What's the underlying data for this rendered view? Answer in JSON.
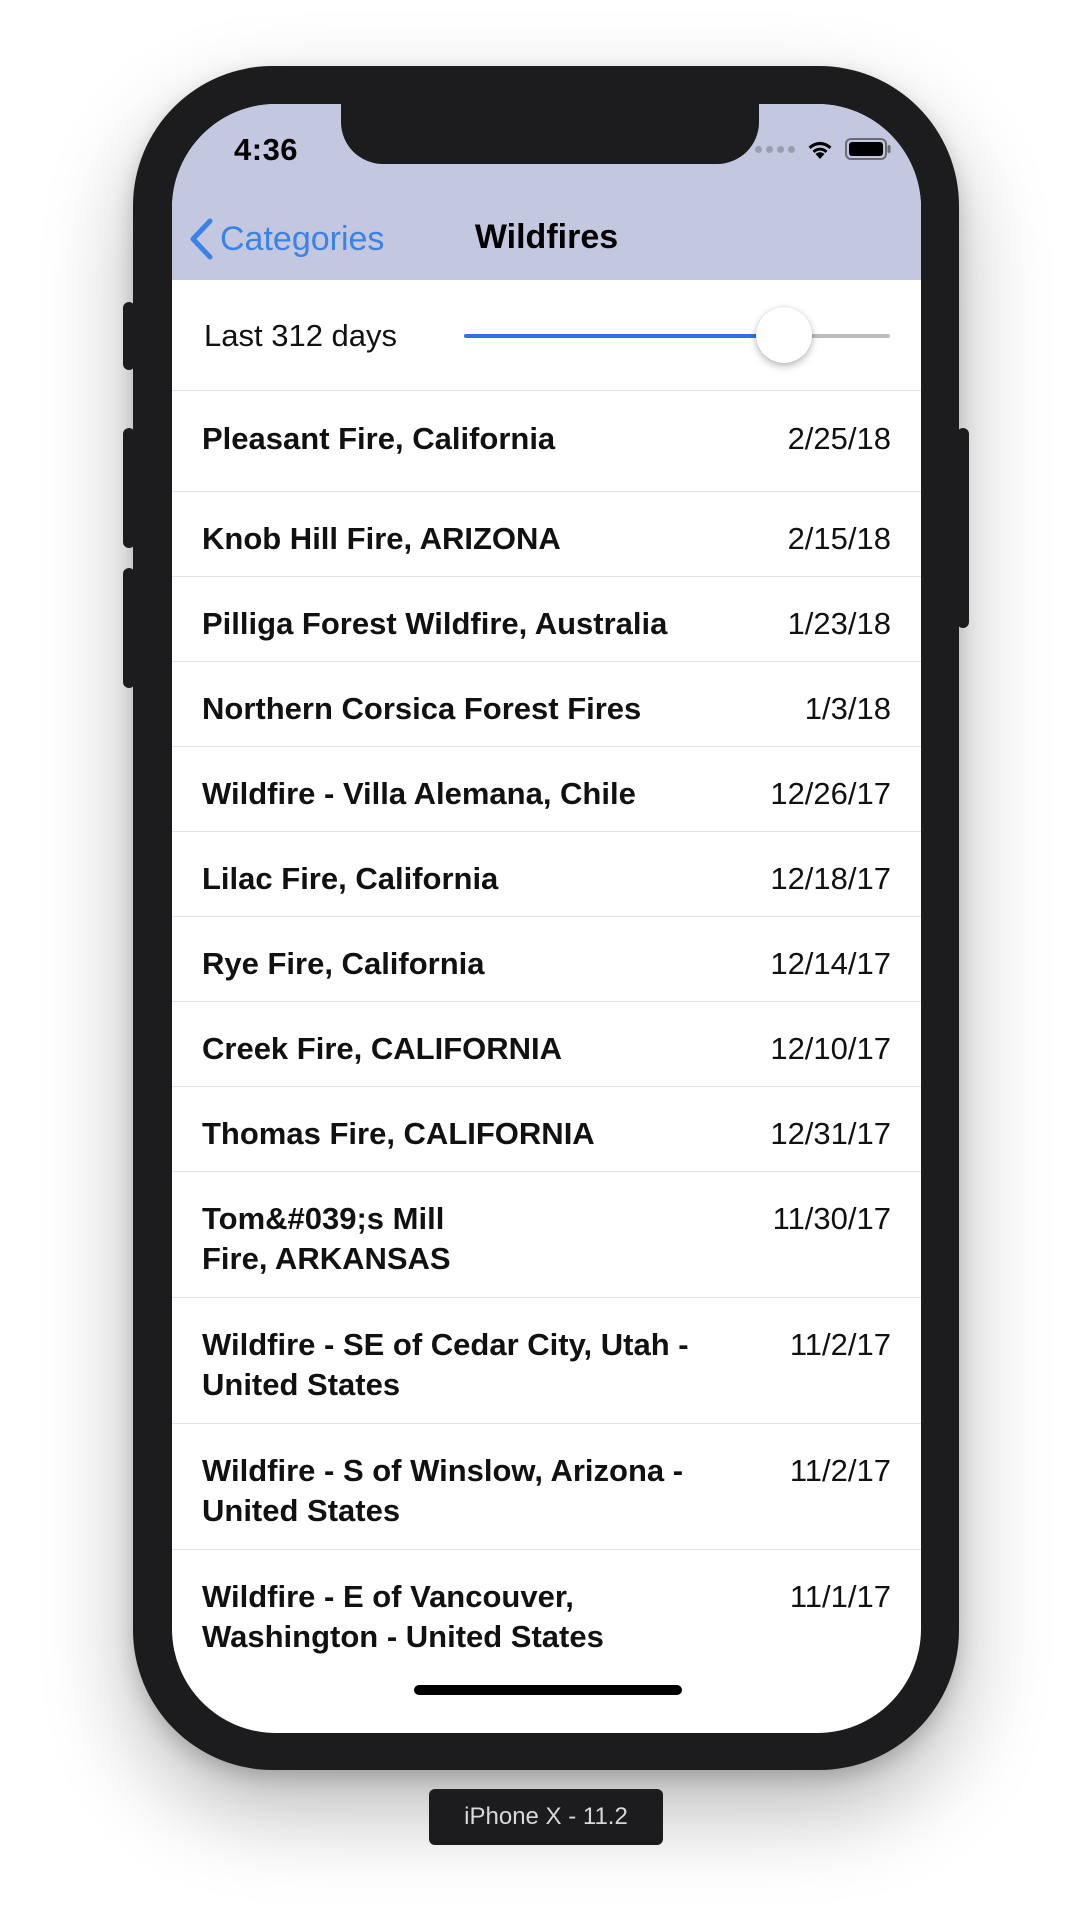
{
  "status_bar": {
    "time": "4:36"
  },
  "nav": {
    "back_label": "Categories",
    "title": "Wildfires"
  },
  "filter": {
    "label": "Last 312 days",
    "slider_value_fraction": 0.75
  },
  "items": [
    {
      "title": "Pleasant Fire, California",
      "date": "2/25/18"
    },
    {
      "title": "Knob Hill Fire, ARIZONA",
      "date": "2/15/18"
    },
    {
      "title": "Pilliga Forest Wildfire, Australia",
      "date": "1/23/18"
    },
    {
      "title": "Northern Corsica Forest Fires",
      "date": "1/3/18"
    },
    {
      "title": "Wildfire - Villa Alemana, Chile",
      "date": "12/26/17"
    },
    {
      "title": "Lilac Fire, California",
      "date": "12/18/17"
    },
    {
      "title": "Rye Fire, California",
      "date": "12/14/17"
    },
    {
      "title": "Creek Fire, CALIFORNIA",
      "date": "12/10/17"
    },
    {
      "title": "Thomas Fire, CALIFORNIA",
      "date": "12/31/17"
    },
    {
      "title": "Tom&#039;s Mill\nFire, ARKANSAS",
      "date": "11/30/17"
    },
    {
      "title": "Wildfire - SE of Cedar City, Utah - United States",
      "date": "11/2/17"
    },
    {
      "title": "Wildfire - S of Winslow, Arizona - United States",
      "date": "11/2/17"
    },
    {
      "title": "Wildfire - E of Vancouver, Washington - United States",
      "date": "11/1/17"
    }
  ],
  "device_label": "iPhone X - 11.2",
  "colors": {
    "nav_background": "#c4c7e0",
    "accent": "#3b82e6",
    "slider_fill": "#2e73e6"
  }
}
